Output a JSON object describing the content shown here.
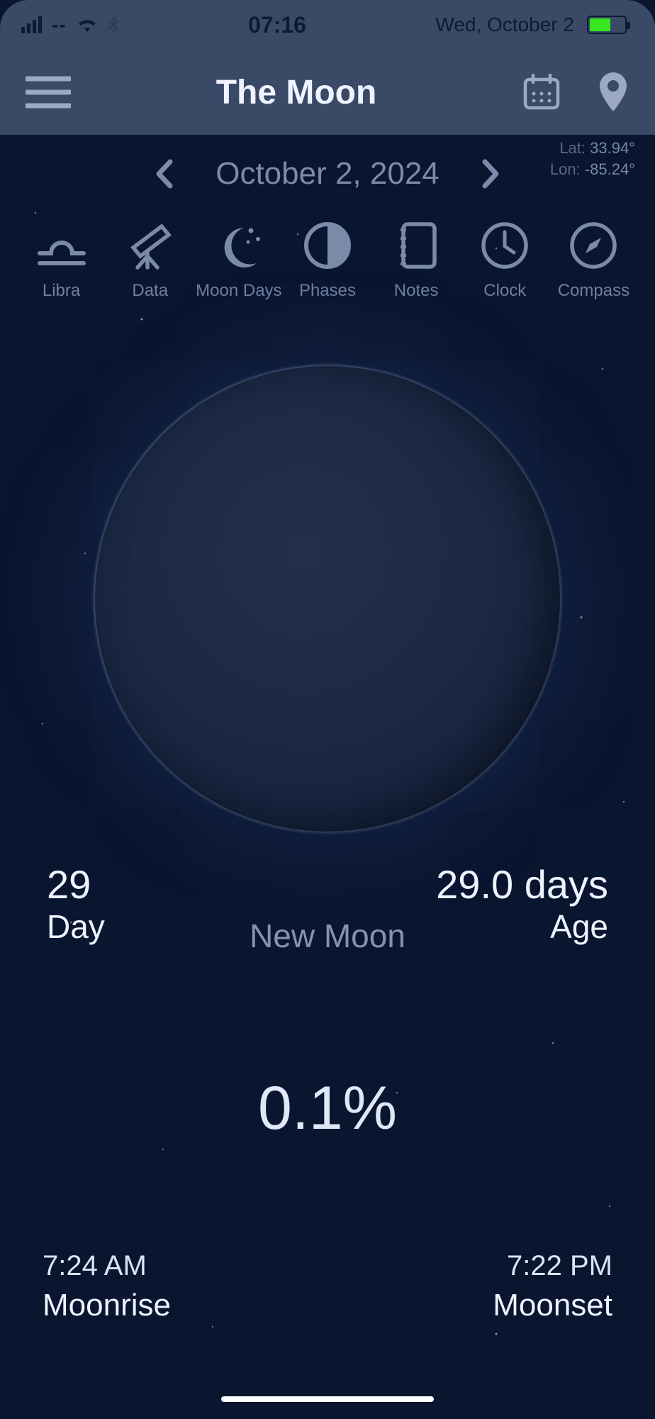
{
  "status": {
    "signal_extra": "--",
    "time": "07:16",
    "date": "Wed, October 2"
  },
  "header": {
    "title": "The Moon"
  },
  "date_nav": {
    "date": "October 2, 2024"
  },
  "location": {
    "lat_label": "Lat:",
    "lat_value": "33.94°",
    "lon_label": "Lon:",
    "lon_value": "-85.24°"
  },
  "tabs": [
    {
      "label": "Libra"
    },
    {
      "label": "Data"
    },
    {
      "label": "Moon Days"
    },
    {
      "label": "Phases"
    },
    {
      "label": "Notes"
    },
    {
      "label": "Clock"
    },
    {
      "label": "Compass"
    }
  ],
  "moon": {
    "day_value": "29",
    "day_label": "Day",
    "age_value": "29.0 days",
    "age_label": "Age",
    "phase_name": "New Moon",
    "illumination": "0.1%",
    "moonrise_time": "7:24 AM",
    "moonrise_label": "Moonrise",
    "moonset_time": "7:22 PM",
    "moonset_label": "Moonset"
  }
}
